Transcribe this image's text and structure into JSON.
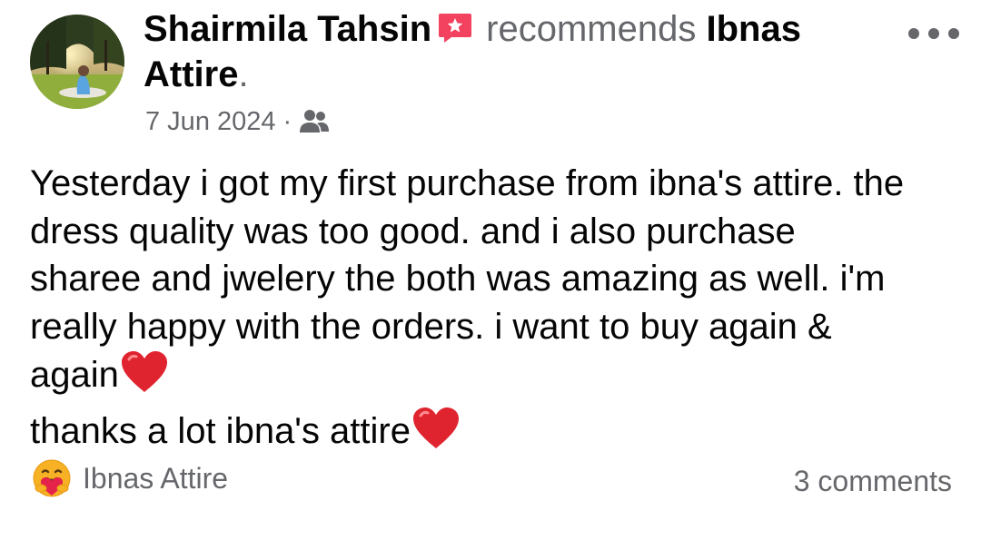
{
  "post": {
    "author": "Shairmila Tahsin",
    "verb": "recommends",
    "page_name": "Ibnas Attire",
    "period": ".",
    "date": "7 Jun 2024",
    "separator": "·",
    "audience_icon": "friends-icon",
    "body_lines": [
      "Yesterday i got my first purchase from ibna's attire. the",
      "dress quality was too good. and i also purchase",
      "sharee and jwelery the both was amazing as well. i'm",
      "really happy with the orders. i want to buy again &",
      "again",
      "thanks a lot ibna's attire"
    ]
  },
  "footer": {
    "reaction_label": "Ibnas Attire",
    "reaction_icon": "care-reaction-icon",
    "comments_label": "3 comments"
  },
  "colors": {
    "text_primary": "#050505",
    "text_secondary": "#65676b",
    "recommend_badge": "#f3425f",
    "heart": "#e0242f"
  }
}
